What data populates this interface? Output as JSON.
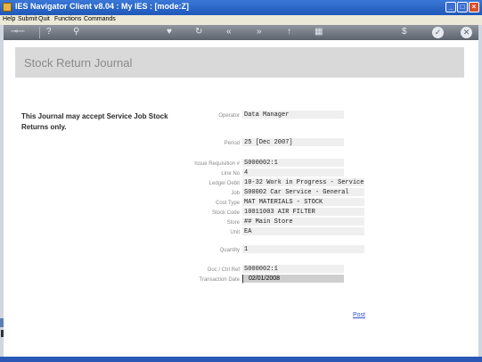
{
  "window": {
    "title": "IES Navigator Client v8.04 : My IES :       [mode:Z]",
    "min": "_",
    "max": "□",
    "close": "×"
  },
  "menu": [
    "Help",
    "Submit",
    "Quit",
    "Functions",
    "Commands"
  ],
  "toolbar": {
    "icons": [
      "key-icon",
      "info-icon",
      "search-icon",
      "heart-icon",
      "refresh-icon",
      "back-icon",
      "forward-icon",
      "up-icon",
      "grid-icon",
      "dollar-icon",
      "check-icon",
      "close-icon"
    ]
  },
  "page": {
    "heading": "Stock Return Journal",
    "note": "This Journal may accept Service Job Stock Returns only."
  },
  "form": {
    "operator": {
      "label": "Operator",
      "value": "Data Manager"
    },
    "period": {
      "label": "Period",
      "value": "25  [Dec 2007]"
    },
    "issue_requisition": {
      "label": "Issue Requisition #",
      "value": "S000002:1"
    },
    "line_no": {
      "label": "Line No",
      "value": "4"
    },
    "ledger_debit": {
      "label": "Ledger Debit",
      "value": "10-32 Work in Progress - Service"
    },
    "job": {
      "label": "Job",
      "value": "S00002 Car Service - General"
    },
    "cost_type": {
      "label": "Cost Type",
      "value": "MAT MATERIALS - STOCK"
    },
    "stock_code": {
      "label": "Stock Code",
      "value": "10011003 AIR FILTER"
    },
    "store": {
      "label": "Store",
      "value": "##  Main Store"
    },
    "unit": {
      "label": "Unit",
      "value": "EA"
    },
    "quantity": {
      "label": "Quantity",
      "value": "1"
    },
    "doc_ref": {
      "label": "Doc / Ctrl Ref",
      "value": "S000002:1"
    },
    "transaction_date": {
      "label": "Transaction Date",
      "value": "02/01/2008"
    }
  },
  "actions": {
    "post": "Post"
  }
}
